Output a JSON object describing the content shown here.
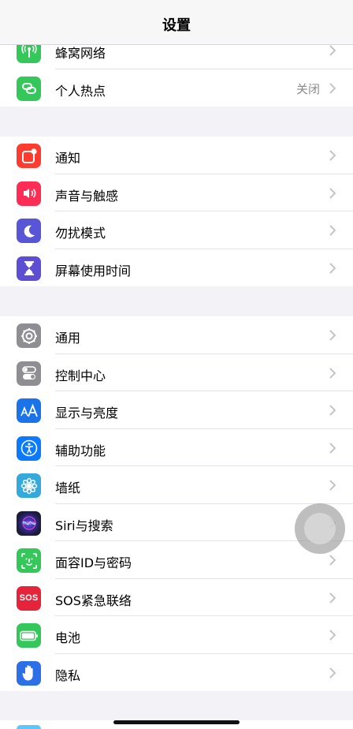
{
  "header": {
    "title": "设置"
  },
  "colors": {
    "cellular": "#34c759",
    "hotspot": "#34c759",
    "notifications": "#ff3b30",
    "sounds": "#ff2d55",
    "dnd": "#5856d6",
    "screentime": "#5e4ed3",
    "general": "#8e8e93",
    "control": "#8e8e93",
    "display": "#1a73e8",
    "accessibility": "#0a7aff",
    "wallpaper": "#34aadc",
    "siri": "#1b1b3a",
    "faceid": "#34c759",
    "sos": "#e5243b",
    "battery": "#34c759",
    "privacy": "#2c6fe6"
  },
  "groups": {
    "connectivity": [
      {
        "label": "蜂窝网络",
        "icon": "antenna-icon"
      },
      {
        "label": "个人热点",
        "icon": "link-icon",
        "value": "关闭"
      }
    ],
    "attention": [
      {
        "label": "通知",
        "icon": "notification-icon"
      },
      {
        "label": "声音与触感",
        "icon": "speaker-icon"
      },
      {
        "label": "勿扰模式",
        "icon": "moon-icon"
      },
      {
        "label": "屏幕使用时间",
        "icon": "hourglass-icon"
      }
    ],
    "system": [
      {
        "label": "通用",
        "icon": "gear-icon"
      },
      {
        "label": "控制中心",
        "icon": "toggles-icon"
      },
      {
        "label": "显示与亮度",
        "icon": "text-size-icon"
      },
      {
        "label": "辅助功能",
        "icon": "accessibility-icon"
      },
      {
        "label": "墙纸",
        "icon": "flower-icon"
      },
      {
        "label": "Siri与搜索",
        "icon": "siri-icon"
      },
      {
        "label": "面容ID与密码",
        "icon": "face-id-icon"
      },
      {
        "label": "SOS紧急联络",
        "icon": "sos-icon",
        "badge": "SOS"
      },
      {
        "label": "电池",
        "icon": "battery-icon"
      },
      {
        "label": "隐私",
        "icon": "hand-icon"
      }
    ]
  }
}
